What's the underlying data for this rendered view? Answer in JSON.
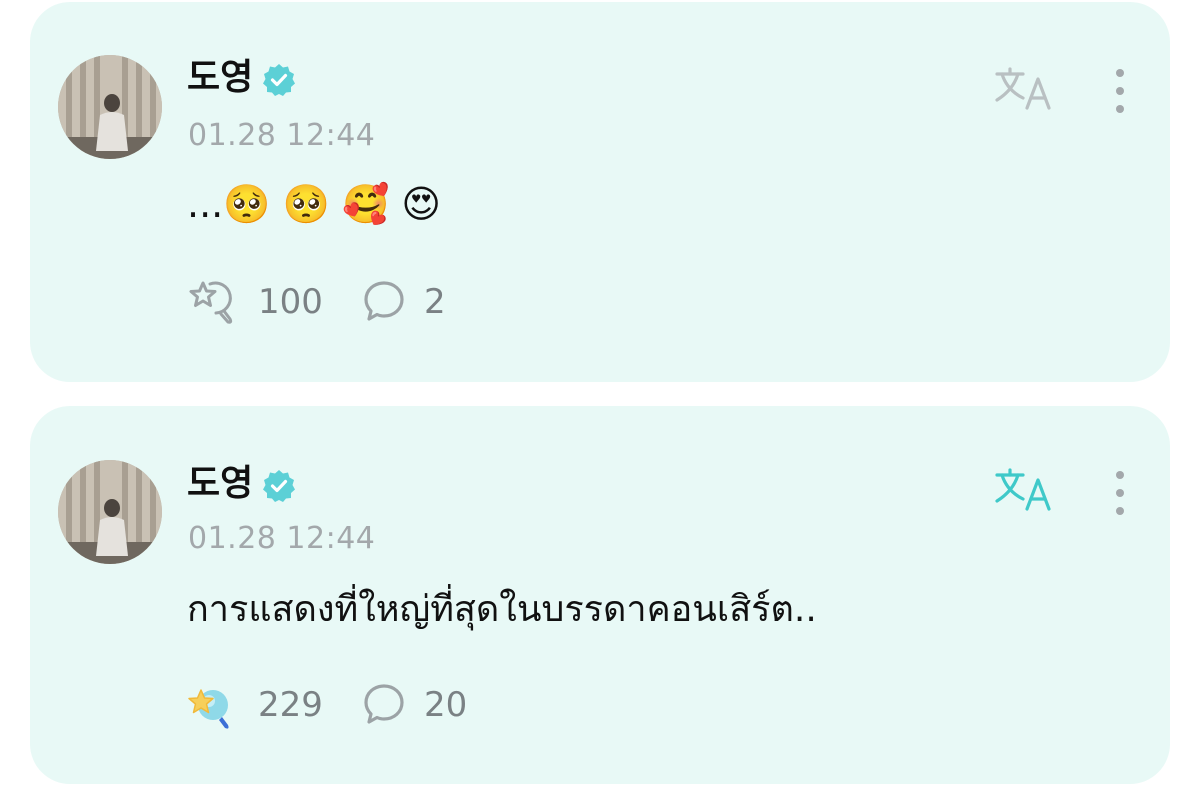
{
  "posts": [
    {
      "author": "도영",
      "timestamp": "01.28 12:44",
      "content": "...🥺 🥺 🥰 😍",
      "reaction_count": "100",
      "comment_count": "2",
      "reacted": false
    },
    {
      "author": "도영",
      "timestamp": "01.28 12:44",
      "content": "การแสดงที่ใหญ่ที่สุดในบรรดาคอนเสิร์ต..",
      "reaction_count": "229",
      "comment_count": "20",
      "reacted": true
    }
  ],
  "icons": {
    "verified": "verified-badge-icon",
    "translate": "translate-icon",
    "more": "more-vertical-icon",
    "reaction": "reaction-star-icon",
    "comment": "comment-bubble-icon"
  },
  "colors": {
    "card_background": "#e8f9f6",
    "accent": "#3fc9c9",
    "verified": "#5cd0d6",
    "muted_text": "#a3a8ab",
    "icon_gray": "#9ca3a6"
  }
}
